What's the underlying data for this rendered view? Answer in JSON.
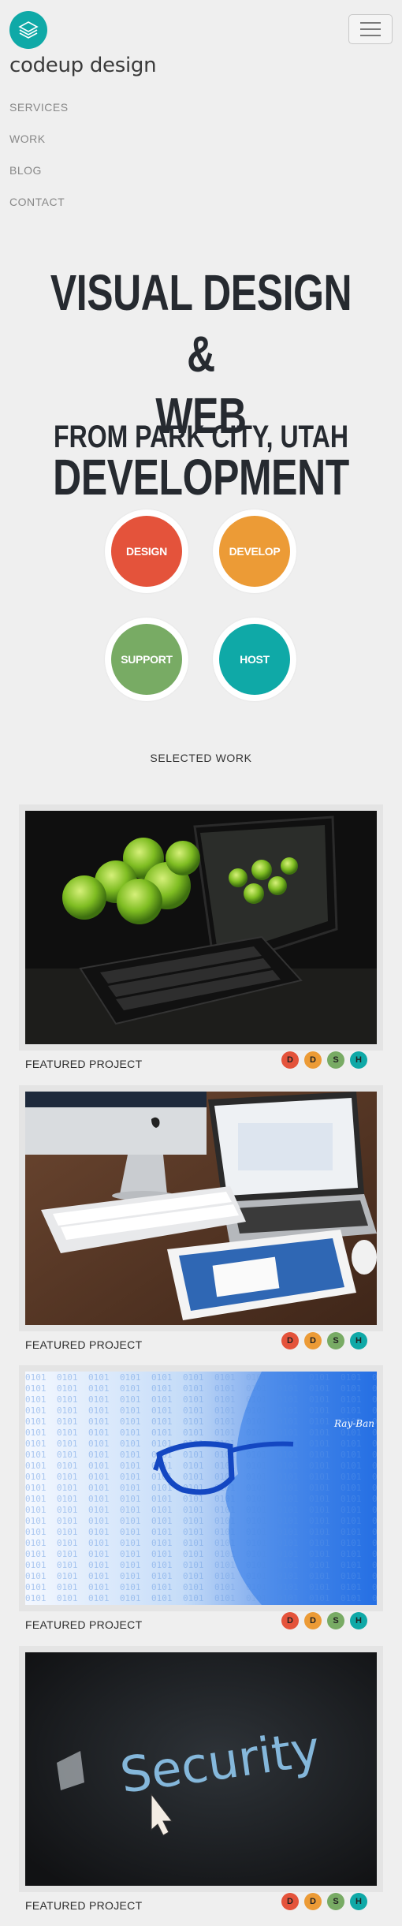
{
  "header": {
    "brand": "codeup design",
    "logo_icon": "layers-icon",
    "menu_icon": "hamburger-icon"
  },
  "nav": {
    "items": [
      {
        "label": "SERVICES"
      },
      {
        "label": "WORK"
      },
      {
        "label": "BLOG"
      },
      {
        "label": "CONTACT"
      }
    ]
  },
  "hero": {
    "title_line1": "VISUAL DESIGN &",
    "title_line2": "WEB DEVELOPMENT",
    "subtitle": "FROM PARK CITY, UTAH"
  },
  "services": [
    {
      "label": "DESIGN",
      "color": "#e4533b"
    },
    {
      "label": "DEVELOP",
      "color": "#ec9b36"
    },
    {
      "label": "SUPPORT",
      "color": "#78ab64"
    },
    {
      "label": "HOST",
      "color": "#0fa9a7"
    }
  ],
  "work": {
    "heading": "SELECTED WORK",
    "projects": [
      {
        "caption": "FEATURED PROJECT",
        "image": "tablet-keyboard-with-green-apples"
      },
      {
        "caption": "FEATURED PROJECT",
        "image": "imac-macbook-ipad-on-desk"
      },
      {
        "caption": "FEATURED PROJECT",
        "image": "glasses-face-binary-code-blue"
      },
      {
        "caption": "FEATURED PROJECT",
        "image": "security-word-pixel-cursor"
      }
    ],
    "badges": [
      {
        "letter": "D",
        "color": "#e4533b"
      },
      {
        "letter": "D",
        "color": "#ec9b36"
      },
      {
        "letter": "S",
        "color": "#78ab64"
      },
      {
        "letter": "H",
        "color": "#0fa9a7"
      }
    ]
  }
}
